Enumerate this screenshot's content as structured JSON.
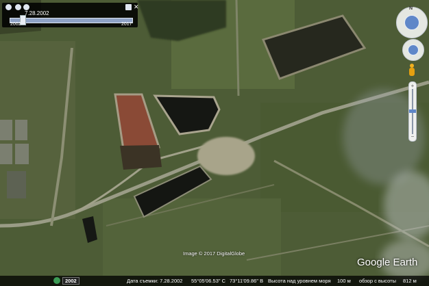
{
  "time_slider": {
    "current_date": "7.28.2002",
    "start_year": "2002",
    "end_year": "2017"
  },
  "credit": "Image © 2017 DigitalGlobe",
  "logo": "Google Earth",
  "status": {
    "year_badge": "2002",
    "capture_date": "Дата съемки: 7.28.2002",
    "latitude": "55°05'06.53\" С",
    "longitude": "73°11'09.86\" В",
    "elevation_label": "Высота над уровнем моря",
    "elevation_value": "100 м",
    "eye_alt_label": "обзор с высоты",
    "eye_alt_value": "812 м"
  },
  "colors": {
    "field": "#4f5f37",
    "red_pond": "#8a4a36",
    "dark_pond": "#161814",
    "road": "#9a9c86",
    "nav_blue": "#5f87c8"
  },
  "icons": [
    "zoom-out-icon",
    "zoom-in-icon",
    "wrench-icon",
    "close-icon",
    "north-icon",
    "pegman-icon",
    "clock-icon"
  ]
}
